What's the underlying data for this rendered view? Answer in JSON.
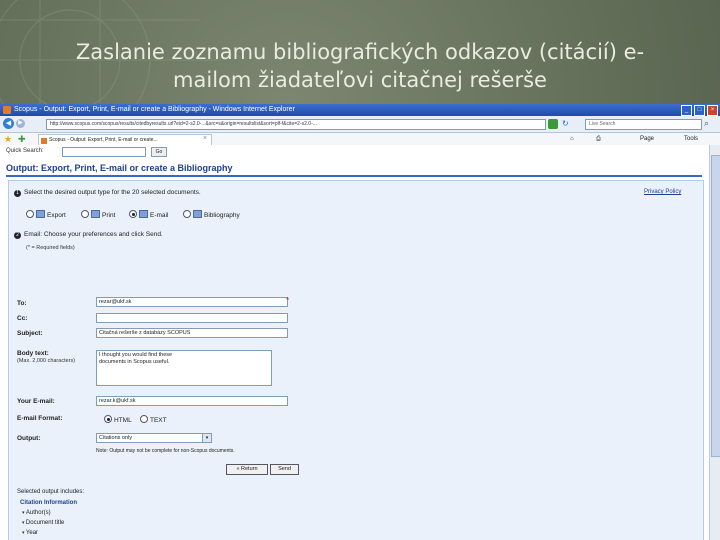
{
  "slide": {
    "title_line1": "Zaslanie zoznamu bibliografických odkazov (citácií) e-",
    "title_line2": "mailom žiadateľovi citačnej rešerše"
  },
  "browser": {
    "window_title": "Scopus - Output: Export, Print, E-mail or create a Bibliography - Windows Internet Explorer",
    "url": "http://www.scopus.com/scopus/results/citedbyresults.url?eid=2-s2.0-...&src=s&origin=resultslist&sort=plf-f&cite=2-s2.0-...",
    "search_placeholder": "Live Search",
    "tab_label": "Scopus - Output: Export, Print, E-mail or create...",
    "cmd_page": "Page",
    "cmd_tools": "Tools"
  },
  "page": {
    "quick_search_label": "Quick Search:",
    "quick_search_button": "Go",
    "heading": "Output: Export, Print, E-mail or create a Bibliography",
    "privacy_link": "Privacy Policy",
    "step1_text": "Select the desired output type for the 20 selected documents.",
    "output_options": [
      "Export",
      "Print",
      "E-mail",
      "Bibliography"
    ],
    "selected_output": "E-mail",
    "step2_text": "Email: Choose your preferences and click Send.",
    "required_note": "(* = Required fields)",
    "to_label": "To:",
    "to_value": "rezar@ukf.sk",
    "cc_label": "Cc:",
    "cc_value": "",
    "subject_label": "Subject:",
    "subject_value": "Citačná rešerše z databázy SCOPUS",
    "body_label": "Body text:",
    "body_hint": "(Max. 2,000 characters)",
    "body_value": "I thought you would find these\ndocuments in Scopus useful.",
    "your_email_label": "Your E-mail:",
    "your_email_value": "rezar.k@ukf.sk",
    "format_label": "E-mail Format:",
    "formats": [
      "HTML",
      "TEXT"
    ],
    "selected_format": "HTML",
    "output_label": "Output:",
    "output_value": "Citations only",
    "note": "Note: Output may not be complete for non-Scopus documents.",
    "return_button": "« Return",
    "send_button": "Send",
    "selected_includes_label": "Selected output includes:",
    "citation_info_label": "Citation Information",
    "citation_items": [
      "Author(s)",
      "Document title",
      "Year"
    ]
  }
}
